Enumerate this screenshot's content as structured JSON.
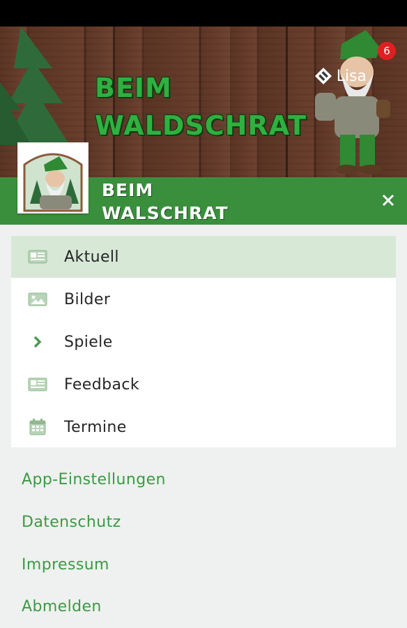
{
  "header": {
    "hero_title_line1": "BEIM",
    "hero_title_line2": "WALDSCHRAT",
    "user_name": "Lisa",
    "notification_count": "6",
    "app_logo_icon": "diamond-logo-icon"
  },
  "band": {
    "title_line1": "BEIM",
    "title_line2": "WALSCHRAT",
    "close_icon": "close-icon"
  },
  "menu": {
    "items": [
      {
        "label": "Aktuell",
        "icon": "news-icon",
        "active": true
      },
      {
        "label": "Bilder",
        "icon": "image-icon",
        "active": false
      },
      {
        "label": "Spiele",
        "icon": "chevron-right-icon",
        "active": false
      },
      {
        "label": "Feedback",
        "icon": "news-icon",
        "active": false
      },
      {
        "label": "Termine",
        "icon": "calendar-icon",
        "active": false
      }
    ]
  },
  "links": {
    "settings": "App-Einstellungen",
    "privacy": "Datenschutz",
    "imprint": "Impressum",
    "logout": "Abmelden"
  },
  "colors": {
    "accent_green": "#3a8f3c",
    "link_green": "#3c9a44",
    "active_bg": "#d7e8d7",
    "badge_red": "#e02020"
  }
}
